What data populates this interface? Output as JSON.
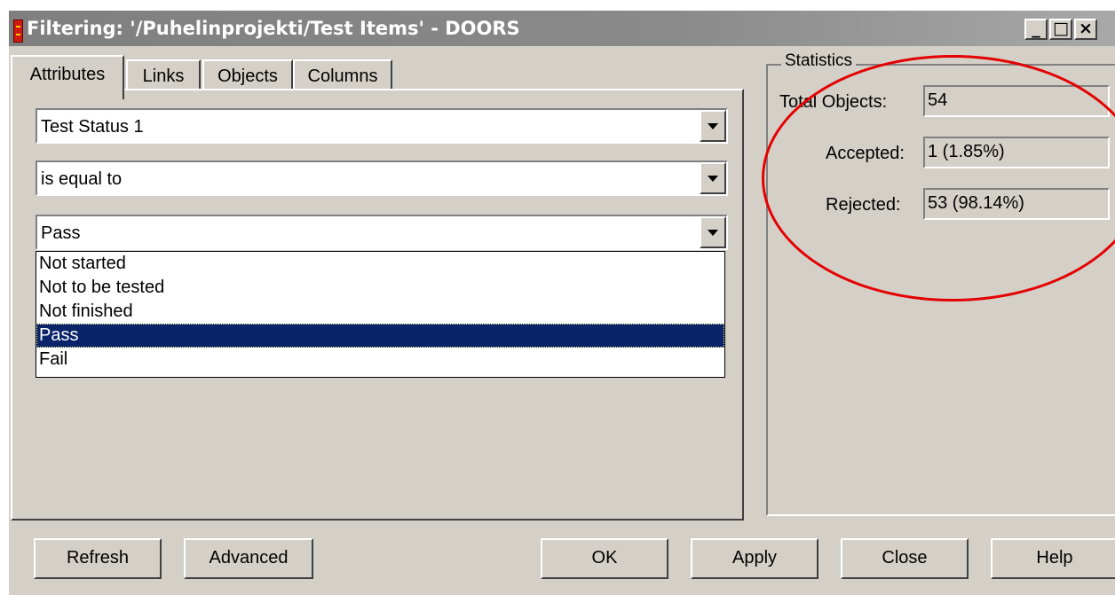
{
  "window": {
    "title": "Filtering: '/Puhelinprojekti/Test Items' - DOORS",
    "minimize": "_",
    "maximize": "□",
    "close": "×"
  },
  "tabs": [
    "Attributes",
    "Links",
    "Objects",
    "Columns"
  ],
  "attributes": {
    "attribute_value": "Test Status 1",
    "condition_value": "is equal to",
    "value_selected": "Pass",
    "options": [
      "Not started",
      "Not to be tested",
      "Not finished",
      "Pass",
      "Fail"
    ]
  },
  "statistics": {
    "legend": "Statistics",
    "total_label": "Total Objects:",
    "total_value": "54",
    "accepted_label": "Accepted:",
    "accepted_value": "1 (1.85%)",
    "rejected_label": "Rejected:",
    "rejected_value": "53 (98.14%)"
  },
  "buttons": {
    "refresh": "Refresh",
    "advanced": "Advanced",
    "ok": "OK",
    "apply": "Apply",
    "close": "Close",
    "help": "Help"
  },
  "colors": {
    "face": "#d4d0c8",
    "selection": "#0a246a",
    "annotation": "#e40000"
  }
}
